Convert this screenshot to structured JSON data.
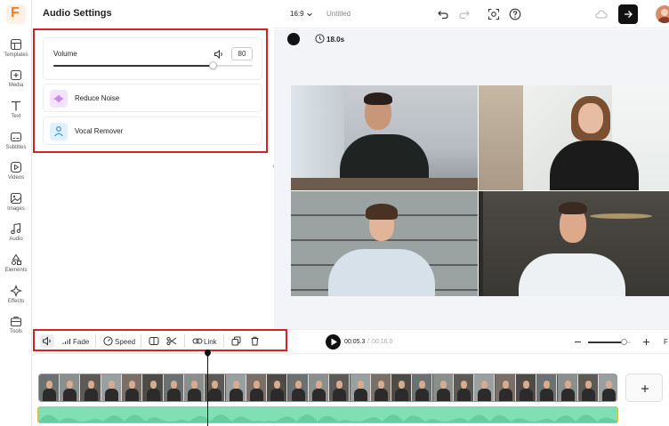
{
  "app": {
    "logo_letter": "F"
  },
  "panel": {
    "title": "Audio Settings"
  },
  "volume": {
    "label": "Volume",
    "value": "80",
    "level": 0.8
  },
  "options": [
    {
      "label": "Reduce Noise",
      "icon": "waveform-icon",
      "icon_bg": "#f3e3ff"
    },
    {
      "label": "Vocal Remover",
      "icon": "person-icon",
      "icon_bg": "#dff0ff"
    }
  ],
  "rail": [
    {
      "label": "Templates",
      "icon": "template-icon"
    },
    {
      "label": "Media",
      "icon": "media-icon"
    },
    {
      "label": "Text",
      "icon": "text-icon"
    },
    {
      "label": "Subtitles",
      "icon": "subtitles-icon"
    },
    {
      "label": "Videos",
      "icon": "video-icon"
    },
    {
      "label": "Images",
      "icon": "image-icon"
    },
    {
      "label": "Audio",
      "icon": "music-icon"
    },
    {
      "label": "Elements",
      "icon": "elements-icon"
    },
    {
      "label": "Effects",
      "icon": "effects-icon"
    },
    {
      "label": "Tools",
      "icon": "tools-icon"
    }
  ],
  "topbar": {
    "ratio": "16:9",
    "project_name": "Untitled"
  },
  "canvas": {
    "duration": "18.0s"
  },
  "toolbar": {
    "fade": "Fade",
    "speed": "Speed",
    "link": "Link"
  },
  "playback": {
    "current": "00:05.3",
    "separator": "/",
    "total": "00:16.0"
  },
  "zoom": {
    "level": 0.85,
    "trailing": "F"
  },
  "colors": {
    "accent": "#f47b20",
    "highlight": "#d42128",
    "audio_track": "#7fe0b4",
    "audio_border": "#e2b64d",
    "canvas_bg": "#f3f4f8"
  }
}
